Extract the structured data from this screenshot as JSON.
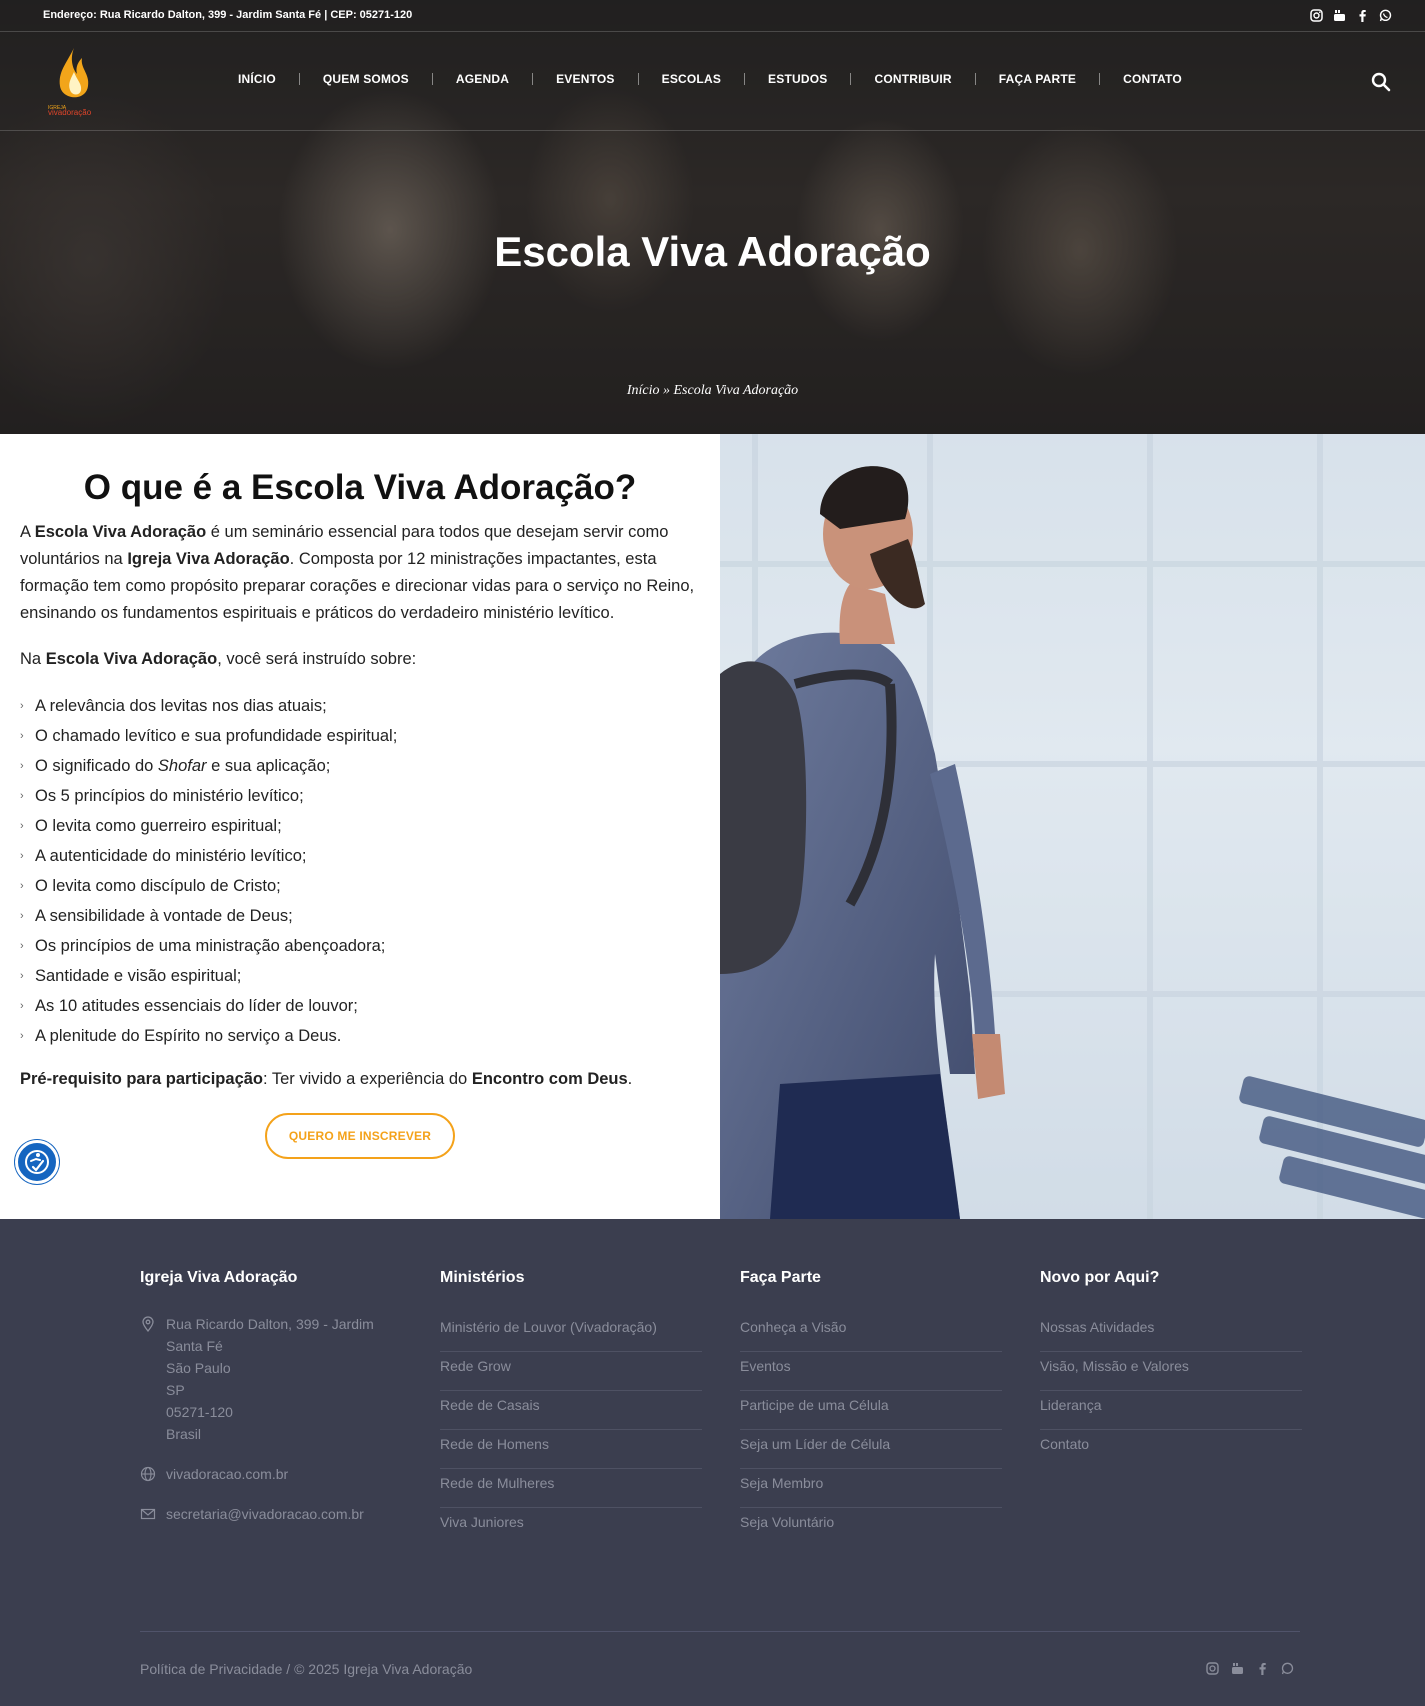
{
  "topbar": {
    "address": "Endereço: Rua Ricardo Dalton, 399 - Jardim Santa Fé | CEP: 05271-120",
    "social_icons": [
      "instagram-icon",
      "youtube-icon",
      "facebook-icon",
      "whatsapp-icon"
    ]
  },
  "nav": {
    "logo_text_top": "IGREJA",
    "logo_text_bottom": "vivadoração",
    "items": [
      "INÍCIO",
      "QUEM SOMOS",
      "AGENDA",
      "EVENTOS",
      "ESCOLAS",
      "ESTUDOS",
      "CONTRIBUIR",
      "FAÇA PARTE",
      "CONTATO"
    ]
  },
  "hero": {
    "title": "Escola Viva Adoração",
    "breadcrumb_home": "Início",
    "breadcrumb_sep": "»",
    "breadcrumb_current": "Escola Viva Adoração"
  },
  "content": {
    "heading": "O que é a Escola Viva Adoração?",
    "intro": {
      "p1": "A ",
      "b1": "Escola Viva Adoração",
      "p2": " é um seminário essencial para todos que desejam servir como voluntários na ",
      "b2": "Igreja Viva Adoração",
      "p3": ". Composta por 12 ministrações impactantes, esta formação tem como propósito preparar corações e direcionar vidas para o serviço no Reino, ensinando os fundamentos espirituais e práticos do verdadeiro ministério levítico."
    },
    "lead": {
      "p1": "Na ",
      "b1": "Escola Viva Adoração",
      "p2": ", você será instruído sobre:"
    },
    "topics": [
      "A relevância dos levitas nos dias atuais;",
      "O chamado levítico e sua profundidade espiritual;",
      "Os 5 princípios do ministério levítico;",
      "O levita como guerreiro espiritual;",
      "A autenticidade do ministério levítico;",
      "O levita como discípulo de Cristo;",
      "A sensibilidade à vontade de Deus;",
      "Os princípios de uma ministração abençoadora;",
      "Santidade e visão espiritual;",
      "As 10 atitudes essenciais do líder de louvor;",
      "A plenitude do Espírito no serviço a Deus."
    ],
    "shofar_item": {
      "p1": "O significado do ",
      "em": "Shofar",
      "p2": " e sua aplicação;"
    },
    "prereq": {
      "b1": "Pré-requisito para participação",
      "p1": ": Ter vivido a experiência do ",
      "b2": "Encontro com Deus",
      "p2": "."
    },
    "cta_label": "QUERO ME INSCREVER"
  },
  "footer": {
    "col1": {
      "title": "Igreja Viva Adoração",
      "address_lines": [
        "Rua Ricardo Dalton, 399 - Jardim",
        "Santa Fé",
        "São Paulo",
        "SP",
        "05271-120",
        "Brasil"
      ],
      "website": "vivadoracao.com.br",
      "email": "secretaria@vivadoracao.com.br"
    },
    "col2": {
      "title": "Ministérios",
      "links": [
        "Ministério de Louvor (Vivadoração)",
        "Rede Grow",
        "Rede de Casais",
        "Rede de Homens",
        "Rede de Mulheres",
        "Viva Juniores"
      ]
    },
    "col3": {
      "title": "Faça Parte",
      "links": [
        "Conheça a Visão",
        "Eventos",
        "Participe de uma Célula",
        "Seja um Líder de Célula",
        "Seja Membro",
        "Seja Voluntário"
      ]
    },
    "col4": {
      "title": "Novo por Aqui?",
      "links": [
        "Nossas Atividades",
        "Visão, Missão e Valores",
        "Liderança",
        "Contato"
      ]
    },
    "copyright": "Política de Privacidade / © 2025 Igreja Viva Adoração"
  },
  "colors": {
    "accent": "#f4a21a",
    "footer_bg": "#3b3e4f",
    "footer_text": "#8a8d9b",
    "accessibility_blue": "#1565c0"
  }
}
